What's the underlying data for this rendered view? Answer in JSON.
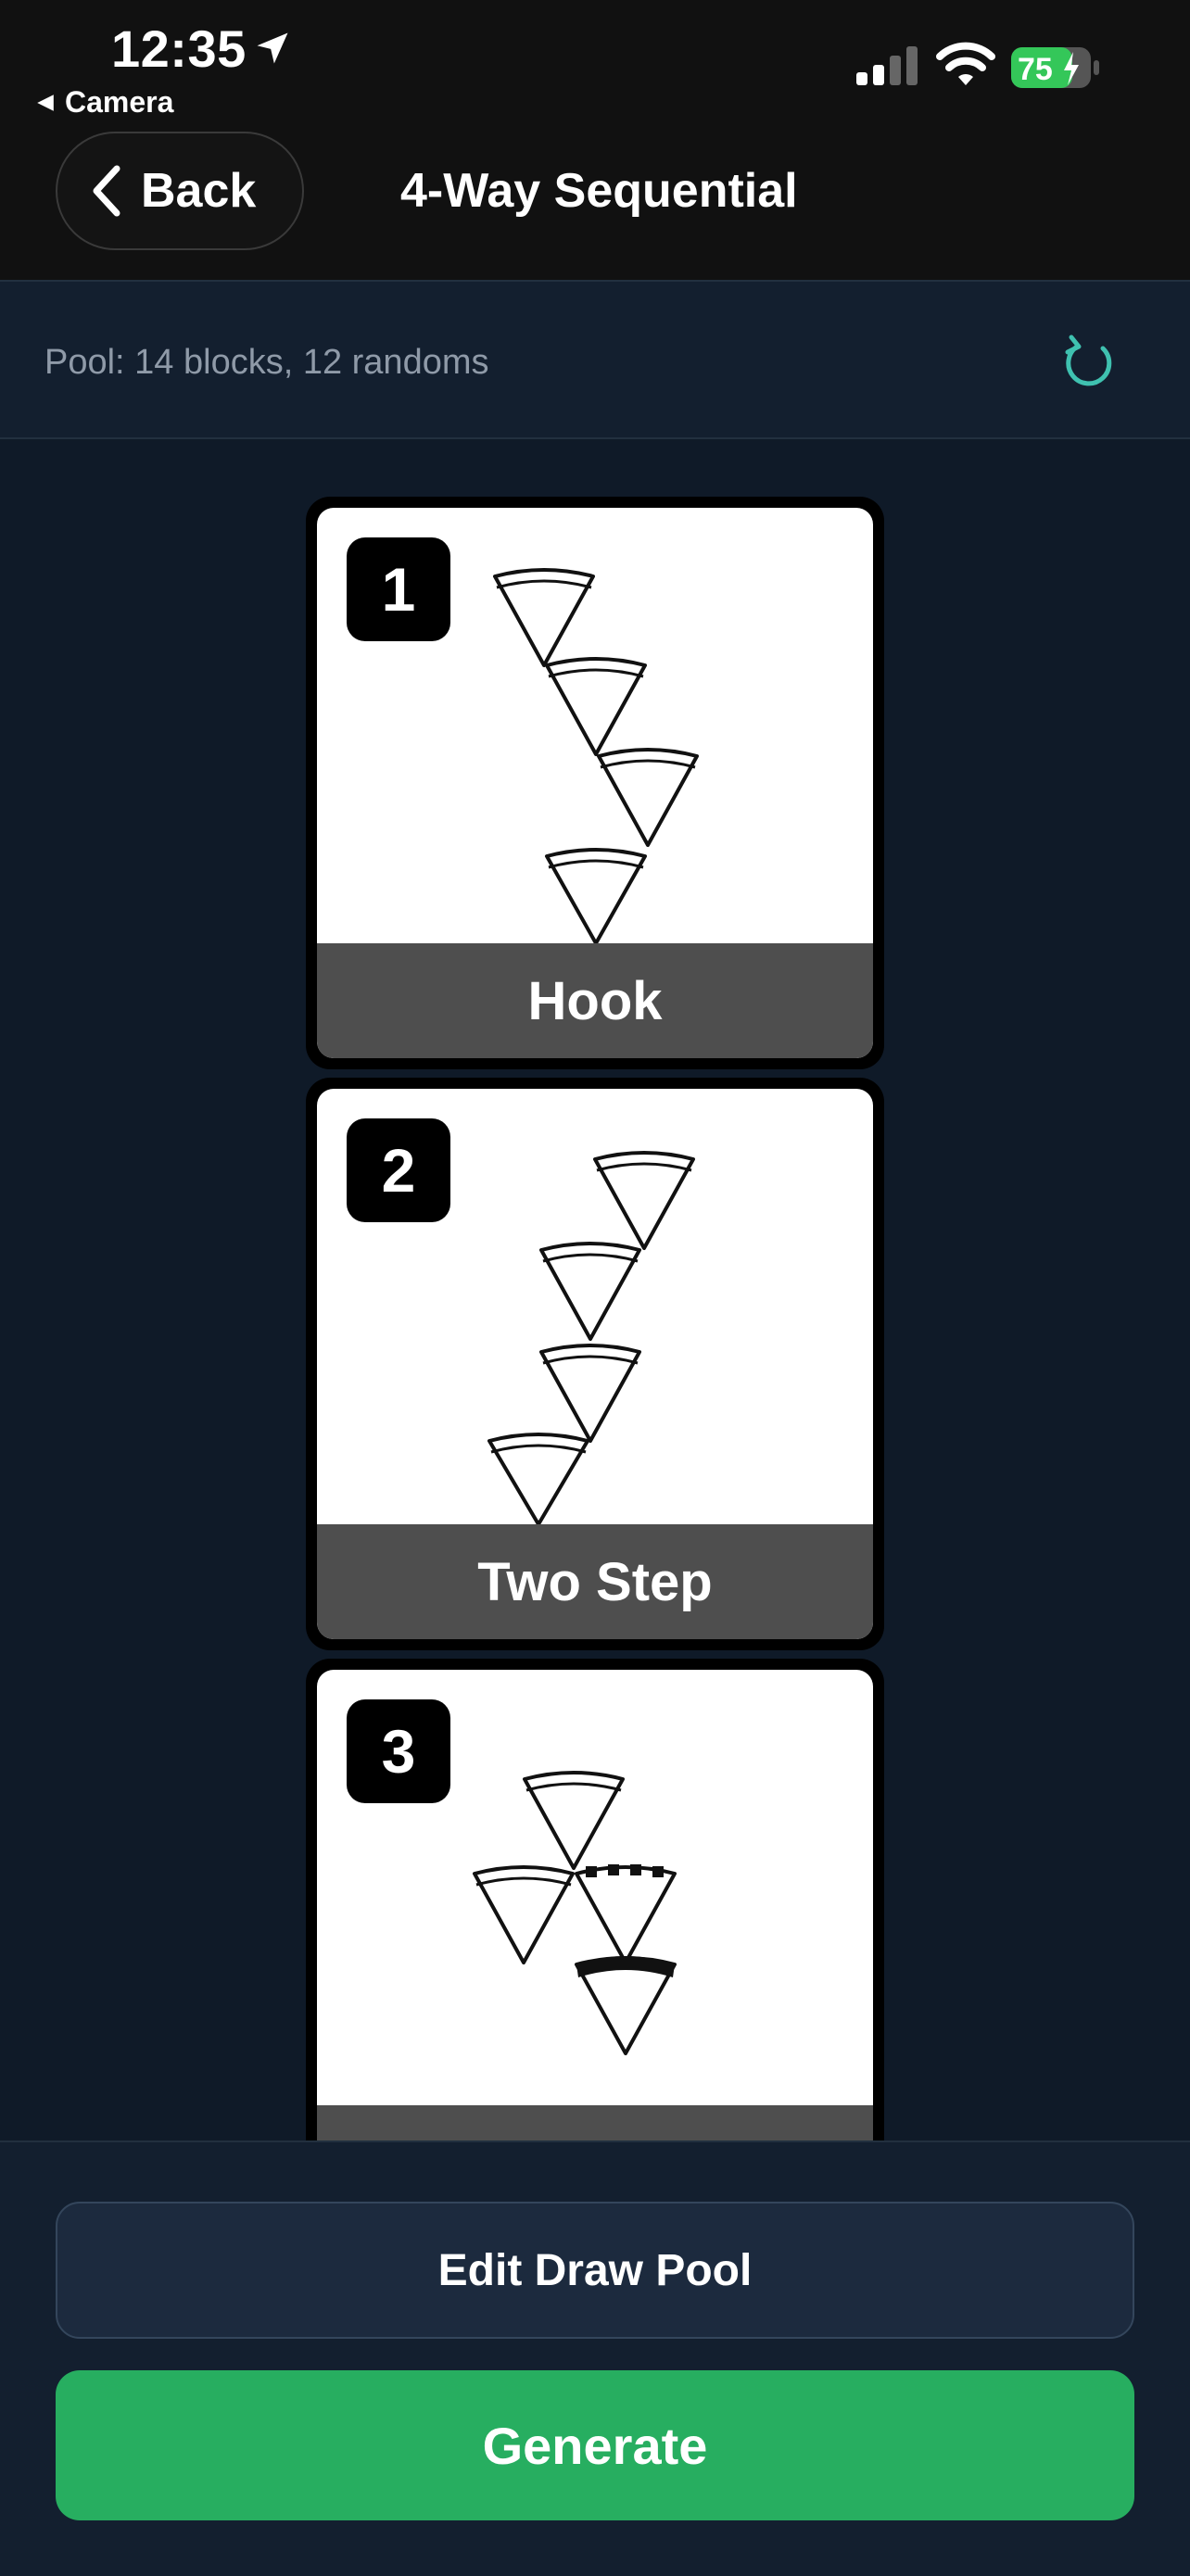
{
  "status_bar": {
    "time": "12:35",
    "back_app": "Camera",
    "battery": "75"
  },
  "header": {
    "back_label": "Back",
    "title": "4-Way Sequential"
  },
  "pool": {
    "summary": "Pool: 14 blocks, 12 randoms",
    "refresh_icon": "refresh-icon"
  },
  "cards": [
    {
      "number": "1",
      "label": "Hook"
    },
    {
      "number": "2",
      "label": "Two Step"
    },
    {
      "number": "3",
      "label": ""
    }
  ],
  "actions": {
    "edit_label": "Edit Draw Pool",
    "generate_label": "Generate"
  },
  "colors": {
    "accent_green": "#27ae60",
    "refresh_teal": "#3fc1b0",
    "battery_green": "#34c759"
  }
}
